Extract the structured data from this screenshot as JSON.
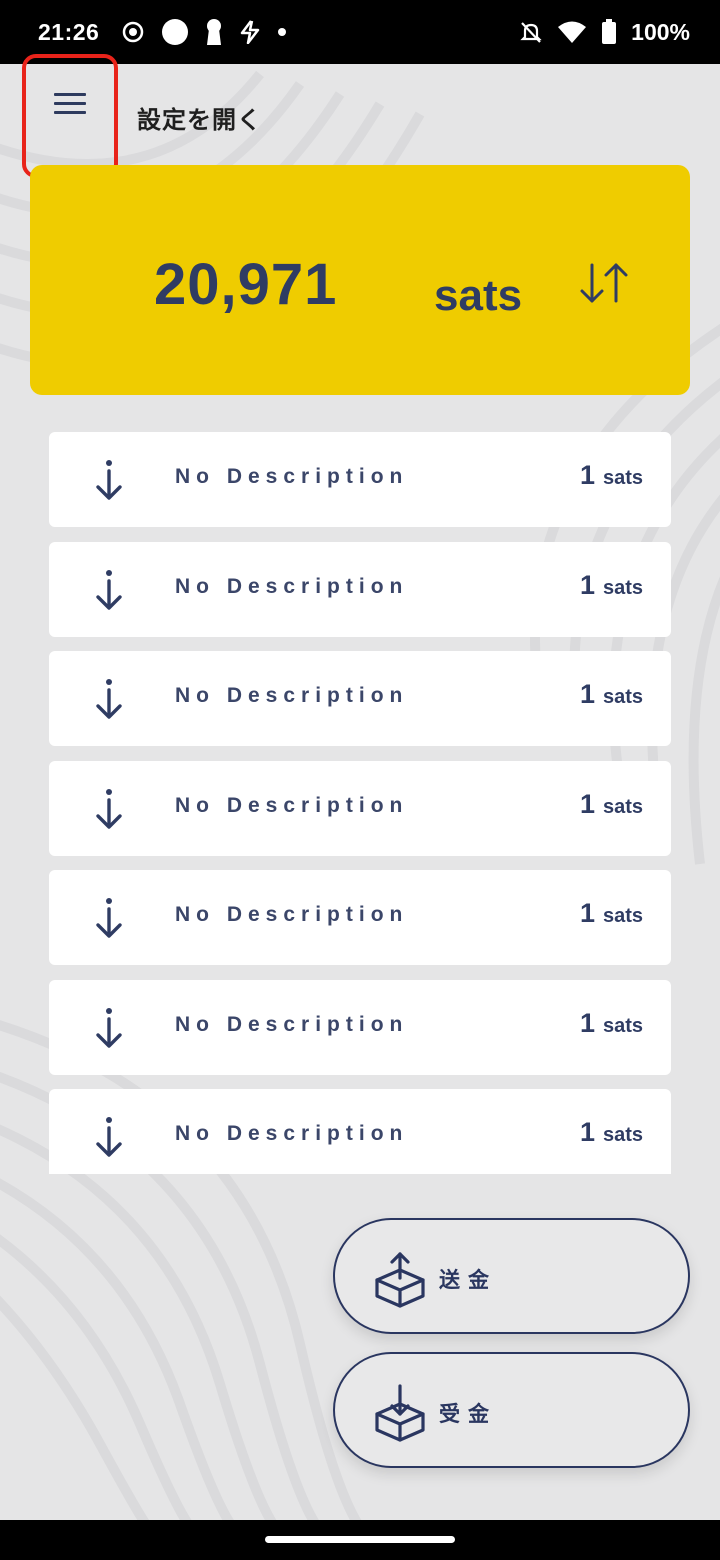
{
  "status_bar": {
    "time": "21:26",
    "battery_text": "100%",
    "icons": [
      "record-icon",
      "circle-icon",
      "keyhole-icon",
      "flash-icon",
      "dot-icon",
      "bell-off-icon",
      "wifi-icon",
      "battery-icon"
    ]
  },
  "header": {
    "menu_icon": "hamburger-menu-icon",
    "title": "設定を開く"
  },
  "balance": {
    "amount": "20,971",
    "unit": "sats",
    "swap_icon": "swap-vertical-icon",
    "card_color": "#efcc00"
  },
  "transactions": [
    {
      "description": "No Description",
      "amount": "1",
      "unit": "sats",
      "icon": "arrow-down-icon"
    },
    {
      "description": "No Description",
      "amount": "1",
      "unit": "sats",
      "icon": "arrow-down-icon"
    },
    {
      "description": "No Description",
      "amount": "1",
      "unit": "sats",
      "icon": "arrow-down-icon"
    },
    {
      "description": "No Description",
      "amount": "1",
      "unit": "sats",
      "icon": "arrow-down-icon"
    },
    {
      "description": "No Description",
      "amount": "1",
      "unit": "sats",
      "icon": "arrow-down-icon"
    },
    {
      "description": "No Description",
      "amount": "1",
      "unit": "sats",
      "icon": "arrow-down-icon"
    },
    {
      "description": "No Description",
      "amount": "1",
      "unit": "sats",
      "icon": "arrow-down-icon"
    }
  ],
  "actions": {
    "send_label": "送金",
    "send_icon": "box-upload-icon",
    "receive_label": "受金",
    "receive_icon": "box-download-icon"
  },
  "colors": {
    "primary_navy": "#2f3c63",
    "accent_yellow": "#efcc00",
    "highlight_red": "#e8231a"
  }
}
